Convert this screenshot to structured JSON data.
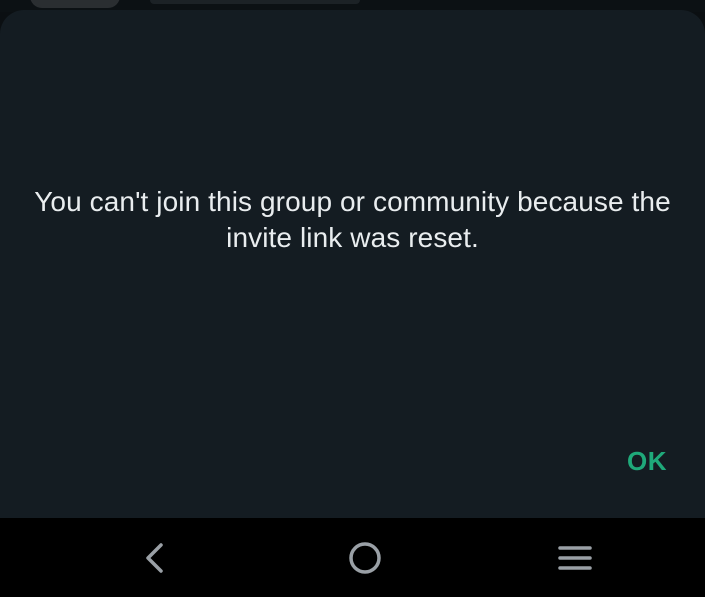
{
  "dialog": {
    "message": "You can't join this group or community because the invite link was reset.",
    "ok_label": "OK"
  },
  "colors": {
    "dialog_background": "#141c22",
    "message_text": "#e9edef",
    "accent": "#1fa97a",
    "navbar_background": "#000000",
    "nav_icon": "#9aa0a6"
  },
  "navbar": {
    "icons": [
      "back-icon",
      "home-icon",
      "recents-icon"
    ]
  }
}
